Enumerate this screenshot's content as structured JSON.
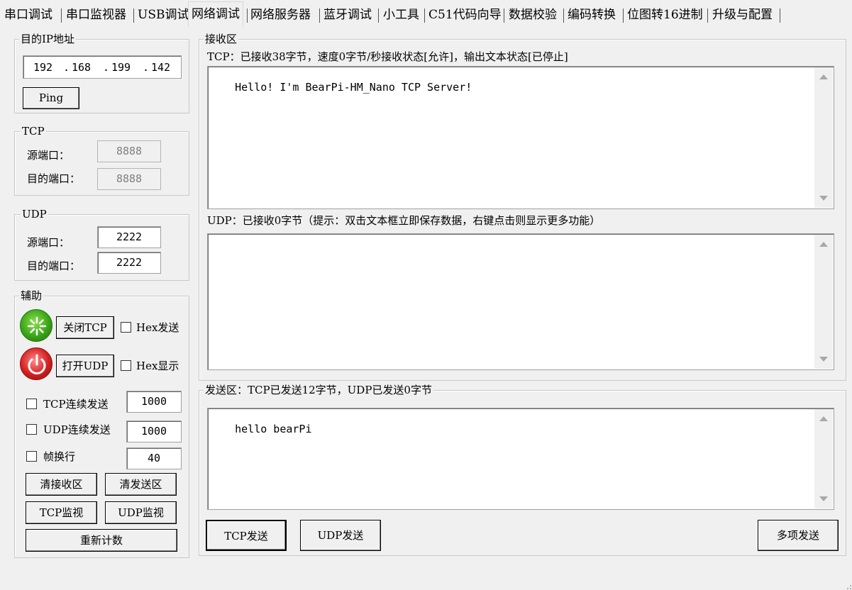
{
  "tabs": [
    {
      "label": "串口调试",
      "active": false
    },
    {
      "label": "串口监视器",
      "active": false
    },
    {
      "label": "USB调试",
      "active": false
    },
    {
      "label": "网络调试",
      "active": true
    },
    {
      "label": "网络服务器",
      "active": false
    },
    {
      "label": "蓝牙调试",
      "active": false
    },
    {
      "label": "小工具",
      "active": false
    },
    {
      "label": "C51代码向导",
      "active": false
    },
    {
      "label": "数据校验",
      "active": false
    },
    {
      "label": "编码转换",
      "active": false
    },
    {
      "label": "位图转16进制",
      "active": false
    },
    {
      "label": "升级与配置",
      "active": false
    }
  ],
  "target_ip": {
    "legend": "目的IP地址",
    "octets": [
      "192",
      "168",
      "199",
      "142"
    ],
    "ping_label": "Ping"
  },
  "tcp": {
    "legend": "TCP",
    "src_port_label": "源端口：",
    "src_port": "8888",
    "dst_port_label": "目的端口：",
    "dst_port": "8888"
  },
  "udp": {
    "legend": "UDP",
    "src_port_label": "源端口：",
    "src_port": "2222",
    "dst_port_label": "目的端口：",
    "dst_port": "2222"
  },
  "assist": {
    "legend": "辅助",
    "close_tcp_label": "关闭TCP",
    "open_udp_label": "打开UDP",
    "hex_send_label": "Hex发送",
    "hex_display_label": "Hex显示",
    "tcp_continuous_label": "TCP连续发送",
    "tcp_continuous_value": "1000",
    "udp_continuous_label": "UDP连续发送",
    "udp_continuous_value": "1000",
    "frame_newline_label": "帧换行",
    "frame_newline_value": "40",
    "clear_receive_label": "清接收区",
    "clear_send_label": "清发送区",
    "tcp_monitor_label": "TCP监视",
    "udp_monitor_label": "UDP监视",
    "reset_count_label": "重新计数",
    "colors": {
      "tcp_icon": "#3aa51a",
      "udp_icon": "#d42020"
    }
  },
  "receive": {
    "legend": "接收区",
    "tcp_status": "TCP：已接收38字节，速度0字节/秒接收状态[允许]，输出文本状态[已停止]",
    "tcp_text": "Hello! I'm BearPi-HM_Nano TCP Server!",
    "udp_status": "UDP：已接收0字节（提示：双击文本框立即保存数据，右键点击则显示更多功能）",
    "udp_text": ""
  },
  "send": {
    "legend": "发送区：TCP已发送12字节，UDP已发送0字节",
    "text": "hello bearPi",
    "tcp_send_label": "TCP发送",
    "udp_send_label": "UDP发送",
    "multi_send_label": "多项发送"
  }
}
